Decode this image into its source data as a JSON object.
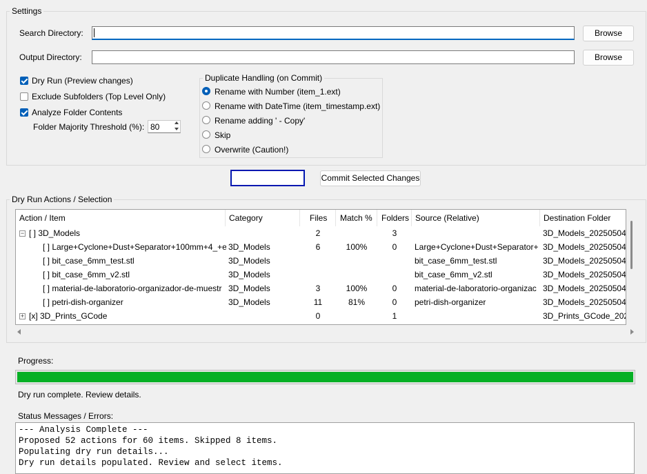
{
  "settings": {
    "legend": "Settings",
    "search_label": "Search Directory:",
    "search_value": "",
    "output_label": "Output Directory:",
    "output_value": "",
    "browse_label": "Browse",
    "dry_run_label": "Dry Run (Preview changes)",
    "dry_run_checked": true,
    "exclude_label": "Exclude Subfolders (Top Level Only)",
    "exclude_checked": false,
    "analyze_label": "Analyze Folder Contents",
    "analyze_checked": true,
    "threshold_label": "Folder Majority Threshold (%):",
    "threshold_value": "80"
  },
  "duplicate": {
    "legend": "Duplicate Handling (on Commit)",
    "options": [
      {
        "label": "Rename with Number (item_1.ext)",
        "selected": true
      },
      {
        "label": "Rename with DateTime (item_timestamp.ext)",
        "selected": false
      },
      {
        "label": "Rename adding ' - Copy'",
        "selected": false
      },
      {
        "label": "Skip",
        "selected": false
      },
      {
        "label": "Overwrite (Caution!)",
        "selected": false
      }
    ]
  },
  "actions": {
    "run_button_label": "",
    "commit_label": "Commit Selected Changes"
  },
  "dryrun": {
    "legend": "Dry Run Actions / Selection",
    "columns": [
      "Action / Item",
      "Category",
      "Files",
      "Match %",
      "Folders",
      "Source (Relative)",
      "Destination Folder"
    ],
    "rows": [
      {
        "expander": "−",
        "item": "[ ] 3D_Models",
        "category": "",
        "files": "2",
        "match": "",
        "folders": "3",
        "source": "",
        "dest": "3D_Models_20250504",
        "level": 0
      },
      {
        "expander": "",
        "item": "[ ] Large+Cyclone+Dust+Separator+100mm+4_+e",
        "category": "3D_Models",
        "files": "6",
        "match": "100%",
        "folders": "0",
        "source": "Large+Cyclone+Dust+Separator+",
        "dest": "3D_Models_20250504",
        "level": 1
      },
      {
        "expander": "",
        "item": "[ ] bit_case_6mm_test.stl",
        "category": "3D_Models",
        "files": "",
        "match": "",
        "folders": "",
        "source": "bit_case_6mm_test.stl",
        "dest": "3D_Models_20250504",
        "level": 1
      },
      {
        "expander": "",
        "item": "[ ] bit_case_6mm_v2.stl",
        "category": "3D_Models",
        "files": "",
        "match": "",
        "folders": "",
        "source": "bit_case_6mm_v2.stl",
        "dest": "3D_Models_20250504",
        "level": 1
      },
      {
        "expander": "",
        "item": "[ ] material-de-laboratorio-organizador-de-muestr",
        "category": "3D_Models",
        "files": "3",
        "match": "100%",
        "folders": "0",
        "source": "material-de-laboratorio-organizac",
        "dest": "3D_Models_20250504",
        "level": 1
      },
      {
        "expander": "",
        "item": "[ ] petri-dish-organizer",
        "category": "3D_Models",
        "files": "11",
        "match": "81%",
        "folders": "0",
        "source": "petri-dish-organizer",
        "dest": "3D_Models_20250504",
        "level": 1
      },
      {
        "expander": "+",
        "item": "[x] 3D_Prints_GCode",
        "category": "",
        "files": "0",
        "match": "",
        "folders": "1",
        "source": "",
        "dest": "3D_Prints_GCode_2025",
        "level": 0
      }
    ]
  },
  "progress": {
    "label": "Progress:",
    "value": 1.0,
    "color": "#06b025",
    "message": "Dry run complete. Review details."
  },
  "status": {
    "label": "Status Messages / Errors:",
    "text": "--- Analysis Complete ---\nProposed 52 actions for 60 items. Skipped 8 items.\nPopulating dry run details...\nDry run details populated. Review and select items."
  }
}
